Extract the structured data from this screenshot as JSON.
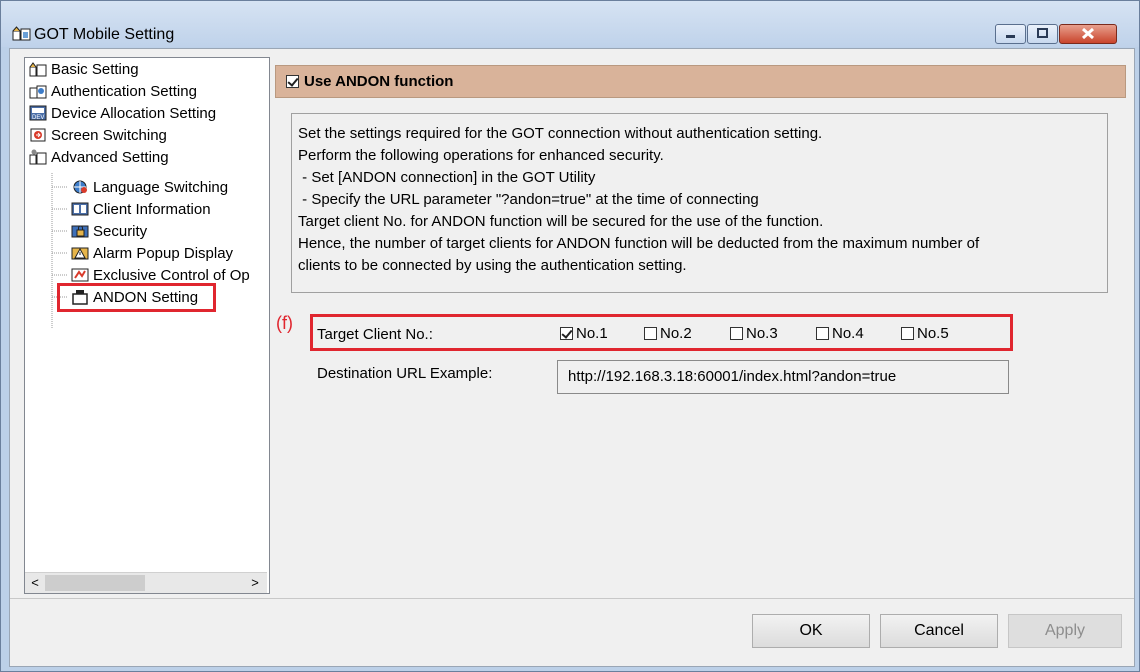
{
  "window": {
    "title": "GOT Mobile Setting"
  },
  "tree": {
    "items": [
      {
        "label": "Basic Setting",
        "icon": "basic-setting-icon"
      },
      {
        "label": "Authentication Setting",
        "icon": "authentication-icon"
      },
      {
        "label": "Device Allocation Setting",
        "icon": "device-icon"
      },
      {
        "label": "Screen Switching",
        "icon": "screen-switching-icon"
      },
      {
        "label": "Advanced Setting",
        "icon": "advanced-setting-icon"
      },
      {
        "label": "Language Switching",
        "icon": "language-icon"
      },
      {
        "label": "Client Information",
        "icon": "client-info-icon"
      },
      {
        "label": "Security",
        "icon": "security-icon"
      },
      {
        "label": "Alarm Popup Display",
        "icon": "alarm-icon"
      },
      {
        "label": "Exclusive Control of Op",
        "icon": "exclusive-control-icon"
      },
      {
        "label": "ANDON Setting",
        "icon": "andon-icon"
      }
    ],
    "scroll_left": "<",
    "scroll_right": ">"
  },
  "andon": {
    "use_label": "Use ANDON function",
    "use_checked": true,
    "description": [
      "Set the settings required for the GOT connection without authentication setting.",
      "Perform the following operations for enhanced security.",
      " - Set [ANDON connection] in the GOT Utility",
      " - Specify the URL parameter \"?andon=true\" at the time of connecting",
      "Target client No. for ANDON function will be secured for the use of the function.",
      "Hence, the number of target clients for ANDON function will be deducted from the maximum number of",
      "clients to be connected by using the authentication setting."
    ],
    "annotation": "(f)",
    "target_label": "Target Client No.:",
    "targets": [
      {
        "label": "No.1",
        "checked": true
      },
      {
        "label": "No.2",
        "checked": false
      },
      {
        "label": "No.3",
        "checked": false
      },
      {
        "label": "No.4",
        "checked": false
      },
      {
        "label": "No.5",
        "checked": false
      }
    ],
    "url_label": "Destination URL Example:",
    "url_value": "http://192.168.3.18:60001/index.html?andon=true"
  },
  "buttons": {
    "ok": "OK",
    "cancel": "Cancel",
    "apply": "Apply"
  },
  "colors": {
    "highlight": "#e0262f",
    "header_bar": "#d9b39a"
  }
}
